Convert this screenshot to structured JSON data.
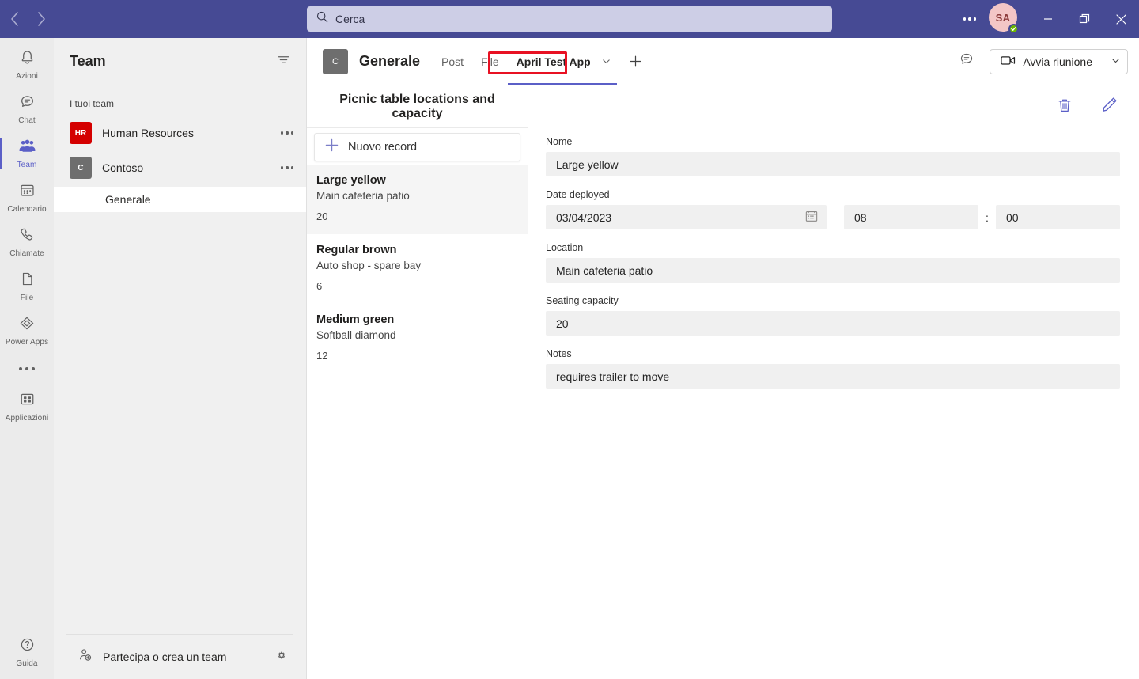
{
  "titlebar": {
    "back_icon": "chevron-left-icon",
    "forward_icon": "chevron-right-icon",
    "search_placeholder": "Cerca",
    "search_value": "",
    "more_label": "...",
    "avatar_initials": "SA",
    "presence_status": "Disponibile",
    "minimize_label": "Riduci a icona",
    "maximize_label": "Ingrandisci",
    "close_label": "Chiudi",
    "bg_color": "#464a94"
  },
  "rail": {
    "items": [
      {
        "label": "Azioni",
        "icon": "bell-icon",
        "active": false
      },
      {
        "label": "Chat",
        "icon": "chat-icon",
        "active": false
      },
      {
        "label": "Team",
        "icon": "people-icon",
        "active": true
      },
      {
        "label": "Calendario",
        "icon": "calendar-icon",
        "active": false
      },
      {
        "label": "Chiamate",
        "icon": "phone-icon",
        "active": false
      },
      {
        "label": "File",
        "icon": "file-icon",
        "active": false
      },
      {
        "label": "Power Apps",
        "icon": "power-apps-icon",
        "active": false
      }
    ],
    "more_label": "Altre app",
    "apps_label": "Applicazioni",
    "help_label": "Guida",
    "accent_color": "#5b5fc7"
  },
  "teams_panel": {
    "title": "Team",
    "filter_icon": "filter-icon",
    "section_label": "I tuoi team",
    "teams": [
      {
        "name": "Human Resources",
        "initials": "HR",
        "color": "#d40000",
        "overflow": "..."
      },
      {
        "name": "Contoso",
        "initials": "C",
        "color": "#6e6e6e",
        "overflow": "..."
      }
    ],
    "channels": [
      {
        "name": "Generale",
        "team": "Contoso",
        "active": true
      }
    ],
    "footer_label": "Partecipa o crea un team",
    "footer_icon": "add-person-icon",
    "settings_icon": "gear-icon"
  },
  "channel_header": {
    "avatar_initials": "C",
    "title": "Generale",
    "tabs": [
      {
        "label": "Post",
        "active": false,
        "has_chevron": false
      },
      {
        "label": "File",
        "active": false,
        "has_chevron": false
      },
      {
        "label": "April Test App",
        "active": true,
        "has_chevron": true,
        "highlighted": true
      }
    ],
    "add_tab_label": "+",
    "chat_icon": "conversation-icon",
    "meeting_button_label": "Avvia riunione",
    "meeting_icon": "video-camera-icon",
    "meeting_caret_icon": "chevron-down-icon"
  },
  "record_list": {
    "title": "Picnic table locations and capacity",
    "new_record_label": "Nuovo record",
    "new_record_icon": "plus-icon",
    "records": [
      {
        "name": "Large yellow",
        "location": "Main cafeteria patio",
        "capacity": "20",
        "selected": true
      },
      {
        "name": "Regular brown",
        "location": "Auto shop - spare bay",
        "capacity": "6",
        "selected": false
      },
      {
        "name": "Medium green",
        "location": "Softball diamond",
        "capacity": "12",
        "selected": false
      }
    ]
  },
  "record_form": {
    "delete_icon": "trash-icon",
    "edit_icon": "pencil-icon",
    "fields": {
      "name_label": "Nome",
      "name_value": "Large yellow",
      "date_label": "Date deployed",
      "date_value": "03/04/2023",
      "date_icon": "calendar-icon",
      "hour_value": "08",
      "time_separator": ":",
      "minute_value": "00",
      "location_label": "Location",
      "location_value": "Main cafeteria patio",
      "capacity_label": "Seating capacity",
      "capacity_value": "20",
      "notes_label": "Notes",
      "notes_value": "requires trailer to move"
    }
  },
  "annotation": {
    "color": "#e81123",
    "target": "April Test App"
  }
}
